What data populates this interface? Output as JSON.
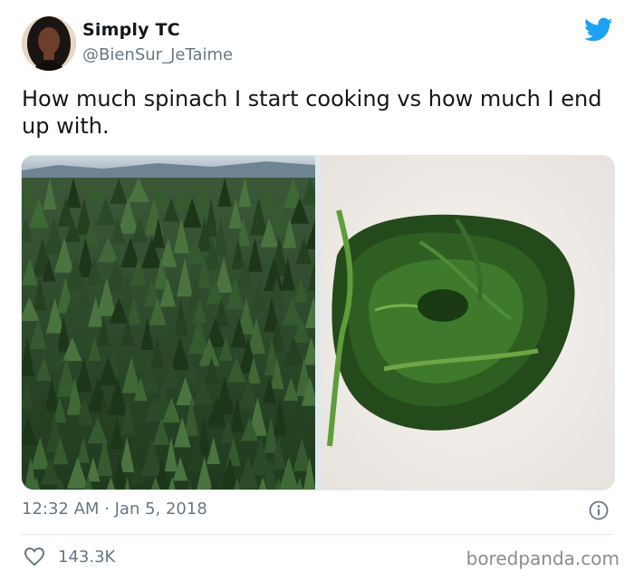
{
  "author": {
    "display_name": "Simply TC",
    "handle": "@BienSur_JeTaime"
  },
  "tweet": {
    "text": "How much spinach I start cooking vs how much I end up with.",
    "timestamp": "12:32 AM · Jan 5, 2018",
    "likes": "143.3K"
  },
  "icons": {
    "brand": "twitter-bird-icon",
    "info": "info-icon",
    "like": "heart-icon"
  },
  "colors": {
    "twitter_blue": "#1da1f2",
    "secondary_text": "#657786"
  },
  "watermark": "boredpanda.com"
}
